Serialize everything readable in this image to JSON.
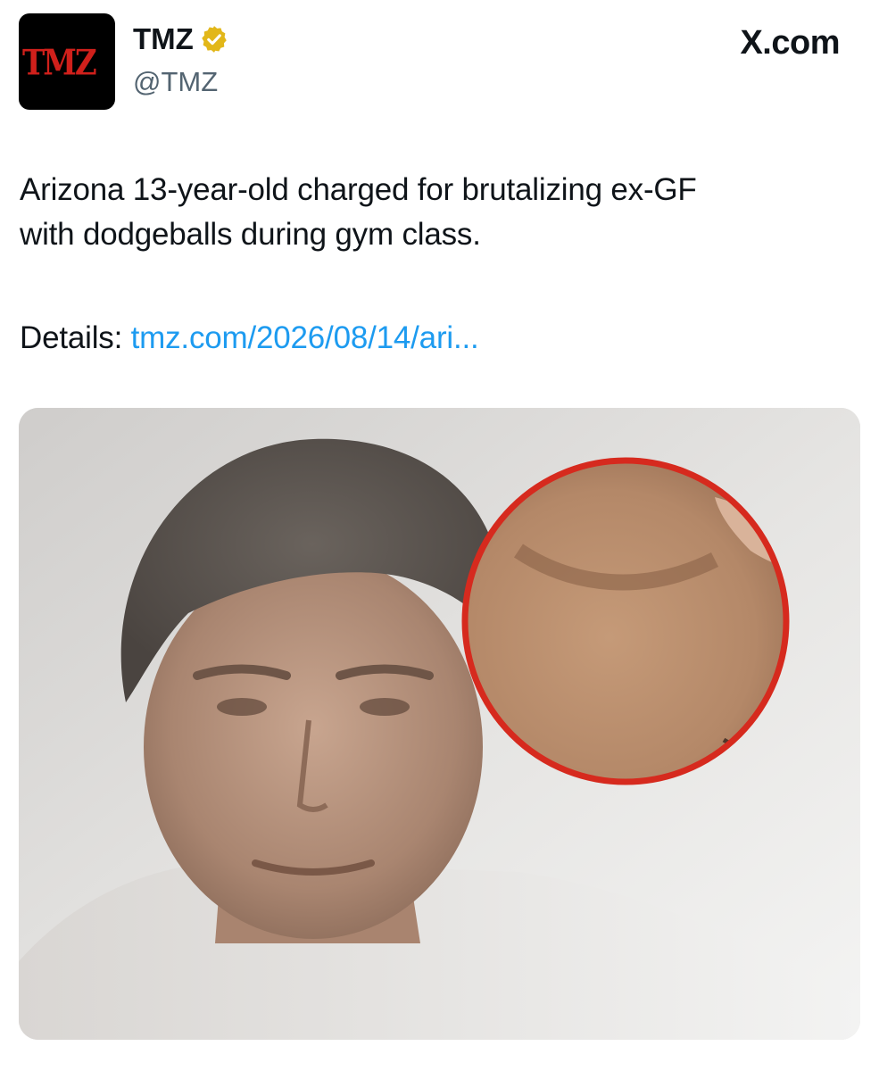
{
  "tweet": {
    "author": {
      "display_name": "TMZ",
      "handle": "@TMZ",
      "verified": true,
      "avatar_logo_text": "TMZ",
      "avatar_colors": {
        "background": "#000000",
        "logo": "#d0201b"
      }
    },
    "source_label": "X.com",
    "text_line_1": "Arizona 13-year-old charged for brutalizing ex-GF",
    "text_line_2": "with dodgeballs during gym class.",
    "details_label": "Details:",
    "link_text": "tmz.com/2026/08/14/ari...",
    "media": {
      "inset_border_color": "#d62a1e"
    }
  },
  "colors": {
    "text": "#0f1419",
    "secondary": "#536471",
    "link": "#1d9bf0",
    "verified_badge": "#e2b719"
  },
  "icons": {
    "verified": "verified-badge-icon"
  }
}
